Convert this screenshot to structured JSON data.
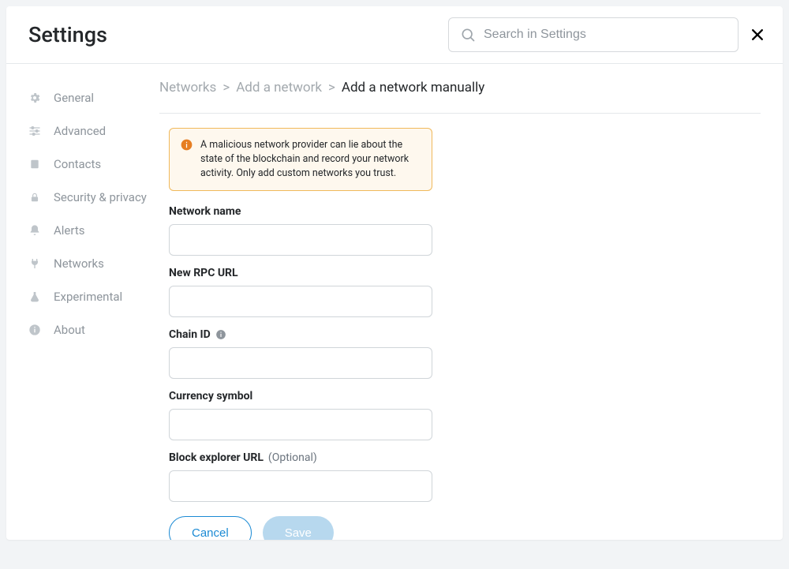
{
  "header": {
    "title": "Settings",
    "search_placeholder": "Search in Settings"
  },
  "sidebar": {
    "items": [
      {
        "label": "General"
      },
      {
        "label": "Advanced"
      },
      {
        "label": "Contacts"
      },
      {
        "label": "Security & privacy"
      },
      {
        "label": "Alerts"
      },
      {
        "label": "Networks"
      },
      {
        "label": "Experimental"
      },
      {
        "label": "About"
      }
    ]
  },
  "breadcrumb": {
    "c1": "Networks",
    "c2": "Add a network",
    "c3": "Add a network manually",
    "sep": ">"
  },
  "warning": {
    "text": "A malicious network provider can lie about the state of the blockchain and record your network activity. Only add custom networks you trust."
  },
  "form": {
    "network_name_label": "Network name",
    "rpc_url_label": "New RPC URL",
    "chain_id_label": "Chain ID",
    "currency_symbol_label": "Currency symbol",
    "block_explorer_label": "Block explorer URL",
    "optional_suffix": "(Optional)",
    "cancel_label": "Cancel",
    "save_label": "Save"
  }
}
